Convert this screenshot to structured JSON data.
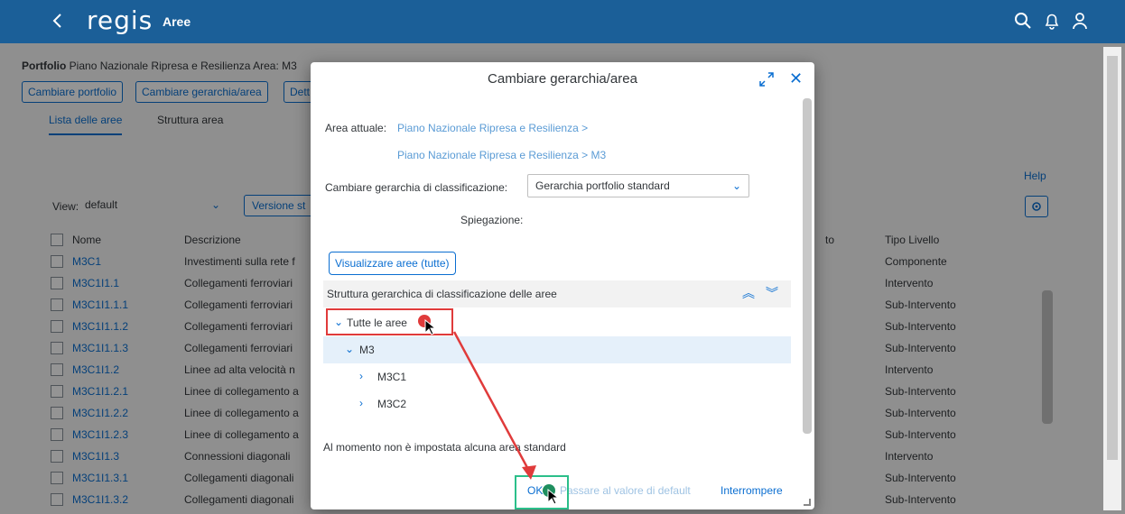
{
  "shell": {
    "logo": "regis",
    "title": "Aree",
    "icons": [
      "back-icon",
      "search-icon",
      "bell-icon",
      "user-icon"
    ]
  },
  "page": {
    "breadcrumb_prefix": "Portfolio",
    "breadcrumb_rest": "Piano Nazionale Ripresa e Resilienza Area: M3",
    "buttons": [
      "Cambiare portfolio",
      "Cambiare gerarchia/area",
      "Dett"
    ],
    "tabs": [
      "Lista delle aree",
      "Struttura area"
    ],
    "help": "Help",
    "view_label": "View:",
    "view_value": "default",
    "versione_label": "Versione st",
    "columns": {
      "nome": "Nome",
      "descrizione": "Descrizione",
      "to": "to",
      "tipo": "Tipo Livello"
    },
    "rows": [
      {
        "nome": "M3C1",
        "desc": "Investimenti sulla rete f",
        "tipo": "Componente"
      },
      {
        "nome": "M3C1I1.1",
        "desc": "Collegamenti ferroviari",
        "tipo": "Intervento"
      },
      {
        "nome": "M3C1I1.1.1",
        "desc": "Collegamenti ferroviari",
        "tipo": "Sub-Intervento"
      },
      {
        "nome": "M3C1I1.1.2",
        "desc": "Collegamenti ferroviari",
        "tipo": "Sub-Intervento"
      },
      {
        "nome": "M3C1I1.1.3",
        "desc": "Collegamenti ferroviari",
        "tipo": "Sub-Intervento"
      },
      {
        "nome": "M3C1I1.2",
        "desc": "Linee ad alta velocità n",
        "tipo": "Intervento"
      },
      {
        "nome": "M3C1I1.2.1",
        "desc": "Linee di collegamento a",
        "tipo": "Sub-Intervento"
      },
      {
        "nome": "M3C1I1.2.2",
        "desc": "Linee di collegamento a",
        "tipo": "Sub-Intervento"
      },
      {
        "nome": "M3C1I1.2.3",
        "desc": "Linee di collegamento a",
        "tipo": "Sub-Intervento"
      },
      {
        "nome": "M3C1I1.3",
        "desc": "Connessioni diagonali",
        "tipo": "Intervento"
      },
      {
        "nome": "M3C1I1.3.1",
        "desc": "Collegamenti diagonali",
        "tipo": "Sub-Intervento"
      },
      {
        "nome": "M3C1I1.3.2",
        "desc": "Collegamenti diagonali",
        "tipo": "Sub-Intervento"
      }
    ]
  },
  "dialog": {
    "title": "Cambiare gerarchia/area",
    "area_label": "Area attuale:",
    "area_line1": "Piano Nazionale Ripresa e Resilienza >",
    "area_line2": "Piano Nazionale Ripresa e Resilienza > M3",
    "gerarchia_label": "Cambiare gerarchia di classificazione:",
    "gerarchia_value": "Gerarchia portfolio standard",
    "spiegazione_label": "Spiegazione:",
    "visualizzare_button": "Visualizzare aree (tutte)",
    "tree_header": "Struttura gerarchica di classificazione delle aree",
    "tree": [
      {
        "label": "Tutte le aree",
        "arrow": "⌄",
        "level": 0
      },
      {
        "label": "M3",
        "arrow": "⌄",
        "level": 1
      },
      {
        "label": "M3C1",
        "arrow": "›",
        "level": 2
      },
      {
        "label": "M3C2",
        "arrow": "›",
        "level": 2
      }
    ],
    "no_default_msg": "Al momento non è impostata alcuna area standard",
    "ok": "OK",
    "passare": "Passare al valore di default",
    "interrompere": "Interrompere"
  },
  "colors": {
    "shell": "#1b5f98",
    "accent": "#0a6ed1",
    "annotation_red": "#e03b3b",
    "annotation_green": "#2bbf8a"
  }
}
